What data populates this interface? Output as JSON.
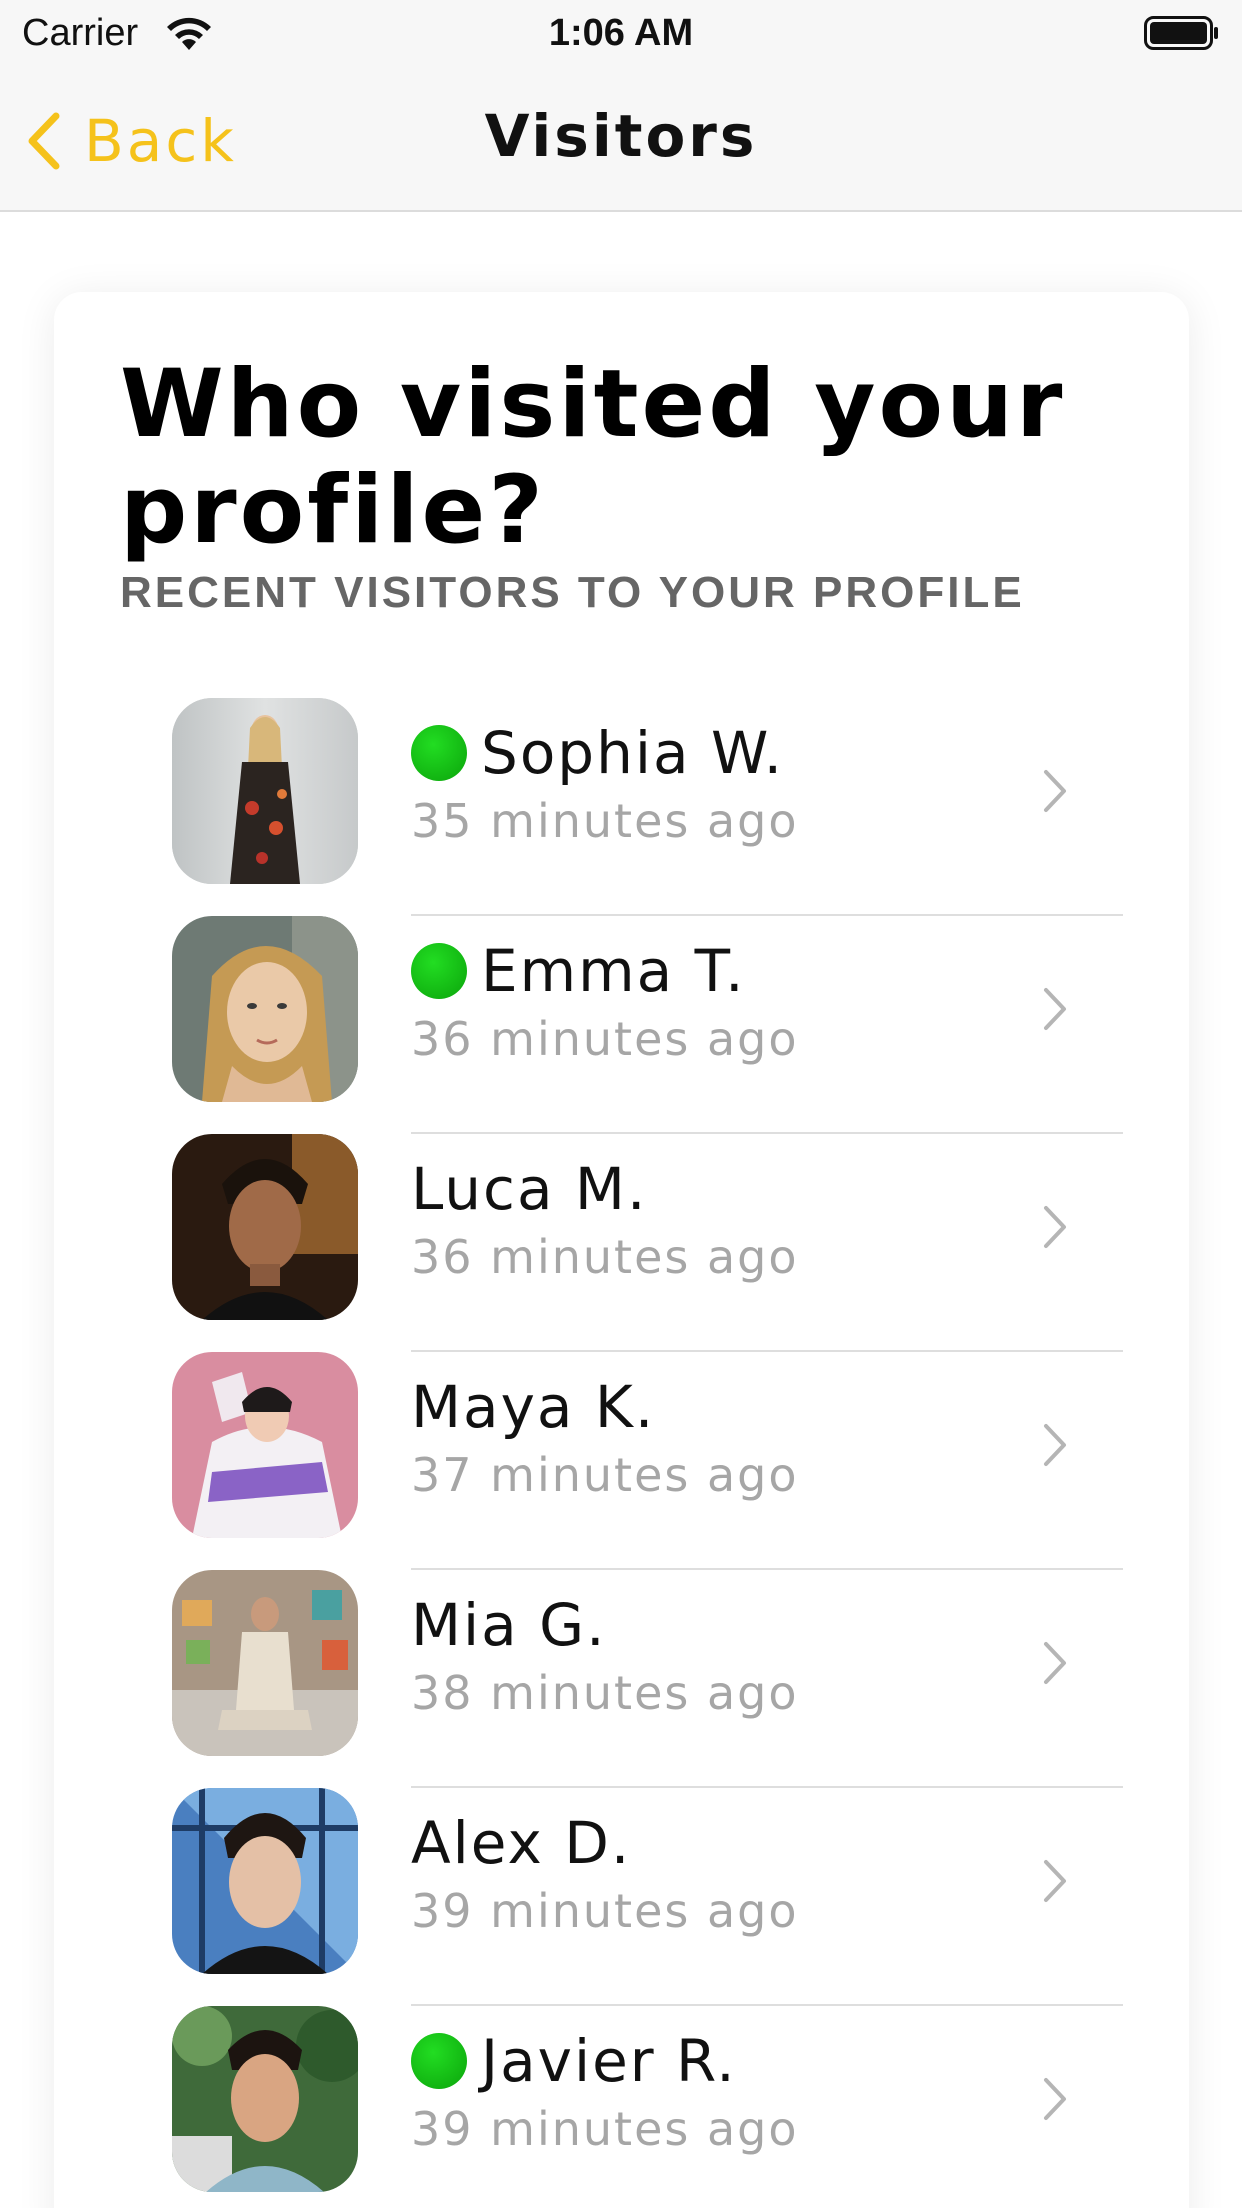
{
  "status_bar": {
    "carrier": "Carrier",
    "time": "1:06 AM",
    "wifi_icon": "wifi-icon",
    "battery_icon": "battery-icon"
  },
  "nav": {
    "back_label": "Back",
    "back_icon": "chevron-left-icon",
    "title": "Visitors",
    "accent_color": "#f5c21b"
  },
  "card": {
    "title": "Who visited your profile?",
    "subtitle": "RECENT VISITORS TO YOUR PROFILE"
  },
  "visitors": [
    {
      "name": "Sophia W.",
      "time": "35 minutes ago",
      "online": true
    },
    {
      "name": "Emma T.",
      "time": "36 minutes ago",
      "online": true
    },
    {
      "name": "Luca M.",
      "time": "36 minutes ago",
      "online": false
    },
    {
      "name": "Maya K.",
      "time": "37 minutes ago",
      "online": false
    },
    {
      "name": "Mia G.",
      "time": "38 minutes ago",
      "online": false
    },
    {
      "name": "Alex D.",
      "time": "39 minutes ago",
      "online": false
    },
    {
      "name": "Javier R.",
      "time": "39 minutes ago",
      "online": true
    }
  ],
  "colors": {
    "online": "#14c414",
    "secondary_text": "#a6a6a6"
  }
}
